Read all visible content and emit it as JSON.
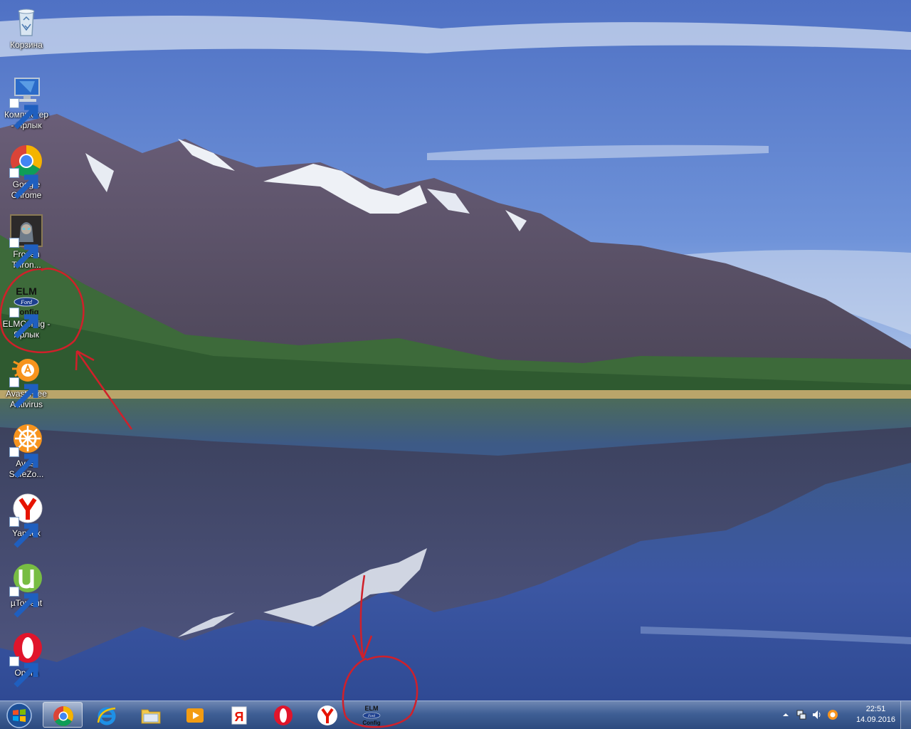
{
  "desktop_icons": [
    {
      "id": "recycle-bin",
      "label": "Корзина",
      "shortcut": false
    },
    {
      "id": "computer",
      "label": "Компьютер\n- Ярлык",
      "shortcut": true
    },
    {
      "id": "google-chrome",
      "label": "Google\nChrome",
      "shortcut": true
    },
    {
      "id": "frozen-throne",
      "label": "Frozen\nThron...",
      "shortcut": true
    },
    {
      "id": "elmconfig",
      "label": "ELMConfig -\nЯрлык",
      "shortcut": true,
      "logo_top": "ELM",
      "logo_mid": "Ford",
      "logo_bot": "onfig"
    },
    {
      "id": "avast-free-antivirus",
      "label": "Avast Free\nAntivirus",
      "shortcut": true
    },
    {
      "id": "avast-safezone",
      "label": "Avast\nSafeZo...",
      "shortcut": true
    },
    {
      "id": "yandex",
      "label": "Yandex",
      "shortcut": true
    },
    {
      "id": "utorrent",
      "label": "µTorrent",
      "shortcut": true
    },
    {
      "id": "opera",
      "label": "Opera",
      "shortcut": true
    }
  ],
  "taskbar": {
    "pinned": [
      {
        "id": "chrome",
        "icon": "chrome-icon",
        "active": true
      },
      {
        "id": "internet-explorer",
        "icon": "internet-explorer-icon",
        "active": false
      },
      {
        "id": "explorer",
        "icon": "folder-icon",
        "active": false
      },
      {
        "id": "media-player",
        "icon": "media-player-icon",
        "active": false
      },
      {
        "id": "yandex-browser",
        "icon": "yandex-ya-icon",
        "active": false
      },
      {
        "id": "opera",
        "icon": "opera-icon",
        "active": false
      },
      {
        "id": "yandex",
        "icon": "yandex-icon",
        "active": false
      },
      {
        "id": "elmconfig",
        "icon": "elmconfig-icon",
        "active": false,
        "logo_top": "ELM",
        "logo_mid": "Ford",
        "logo_bot": "Config"
      }
    ],
    "tray": {
      "time": "22:51",
      "date": "14.09.2016",
      "icons": [
        "show-hidden-icons-arrow",
        "network-icon",
        "volume-icon",
        "avast-tray-icon"
      ]
    }
  },
  "colors": {
    "sky_top": "#5d7fcf",
    "sky_horizon": "#a8c2e8",
    "lake": "#3f5fa8",
    "annotation_red": "#d0202a",
    "taskbar": "#3f5f95"
  }
}
